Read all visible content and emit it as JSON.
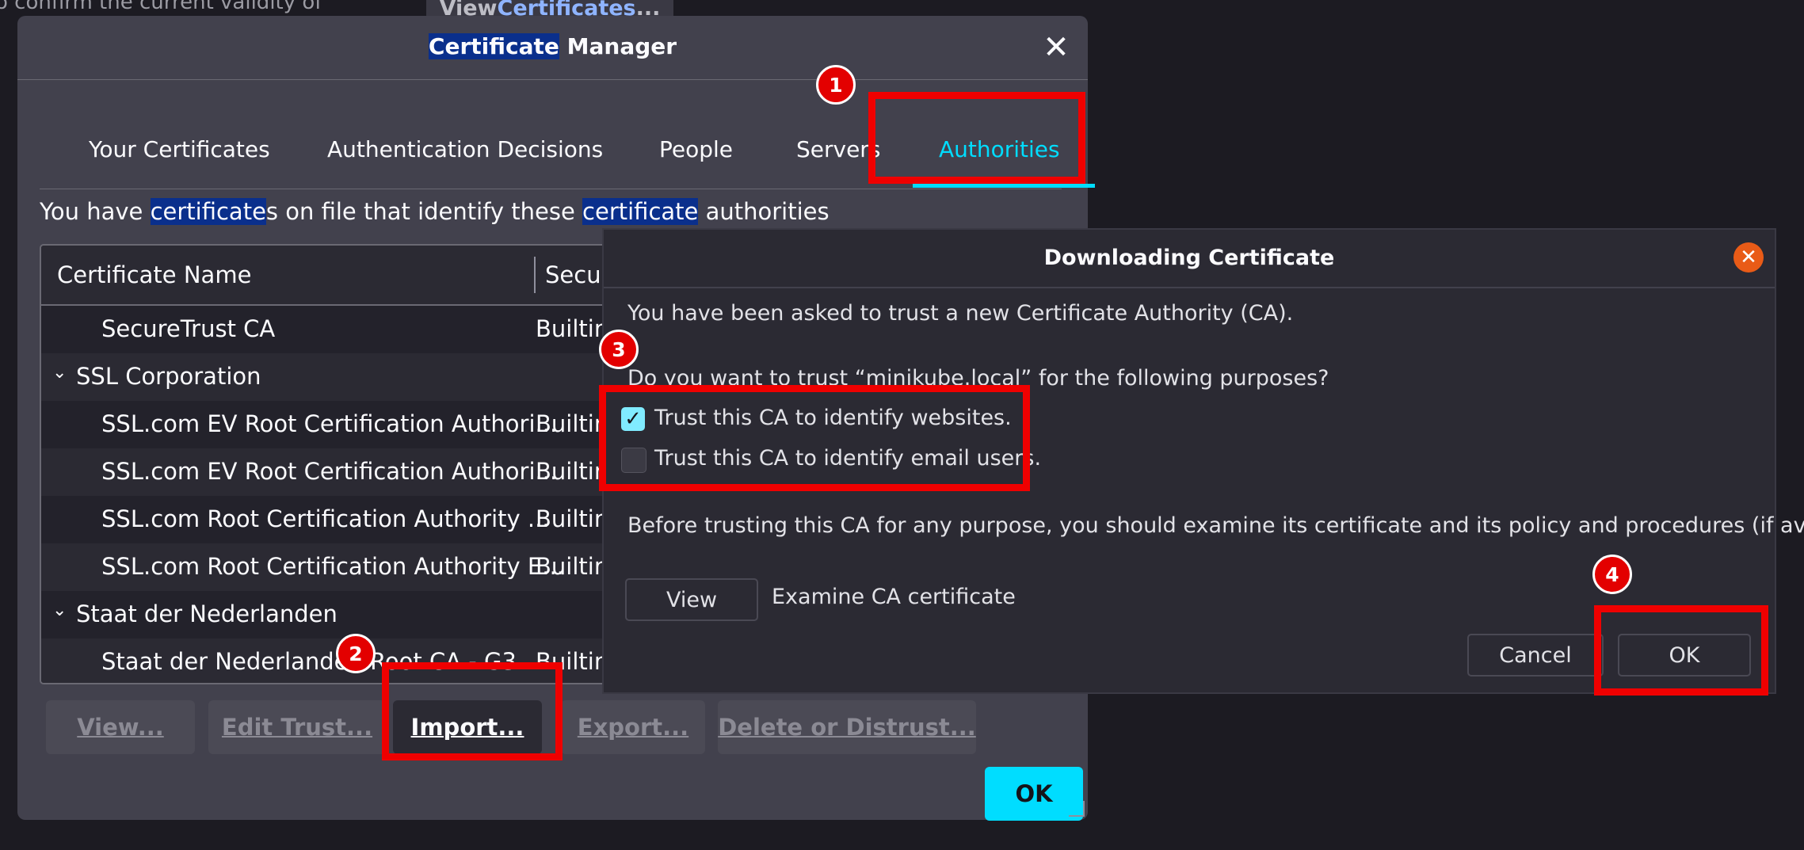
{
  "background": {
    "partial_text": "o confirm the current validity of",
    "view_button": {
      "prefix": "View ",
      "highlight": "Certificates",
      "suffix": "..."
    }
  },
  "manager": {
    "title_highlight": "Certificate",
    "title_rest": " Manager",
    "tabs": [
      "Your Certificates",
      "Authentication Decisions",
      "People",
      "Servers",
      "Authorities"
    ],
    "active_tab": "Authorities",
    "description": {
      "part1": "You have ",
      "hl1": "certificate",
      "part2": "s on file that identify these ",
      "hl2": "certificate",
      "part3": " authorities"
    },
    "columns": [
      "Certificate Name",
      "Secu"
    ],
    "rows": [
      {
        "name": "SecureTrust CA",
        "security": "Builtin",
        "group": false
      },
      {
        "name": "SSL Corporation",
        "security": "",
        "group": true
      },
      {
        "name": "SSL.com EV Root Certification Authori...",
        "security": "Builtin",
        "group": false
      },
      {
        "name": "SSL.com EV Root Certification Authori...",
        "security": "Builtin",
        "group": false
      },
      {
        "name": "SSL.com Root Certification Authority ...",
        "security": "Builtin",
        "group": false
      },
      {
        "name": "SSL.com Root Certification Authority E...",
        "security": "Builtin",
        "group": false
      },
      {
        "name": "Staat der Nederlanden",
        "security": "",
        "group": true
      },
      {
        "name": "Staat der Nederlanden Root CA - G3",
        "security": "Builtin",
        "group": false
      }
    ],
    "buttons": {
      "view": "View...",
      "edit_trust": "Edit Trust...",
      "import": "Import...",
      "export": "Export...",
      "delete": "Delete or Distrust..."
    },
    "ok": "OK"
  },
  "dialog": {
    "title": "Downloading Certificate",
    "line1": "You have been asked to trust a new Certificate Authority (CA).",
    "line2": "Do you want to trust “minikube.local” for the following purposes?",
    "check_websites": {
      "label": "Trust this CA to identify websites.",
      "checked": true
    },
    "check_email": {
      "label": "Trust this CA to identify email users.",
      "checked": false
    },
    "line3": "Before trusting this CA for any purpose, you should examine its certificate and its policy and procedures (if available).",
    "view_button": "View",
    "view_caption": "Examine CA certificate",
    "cancel": "Cancel",
    "ok": "OK"
  },
  "markers": [
    "1",
    "2",
    "3",
    "4"
  ],
  "colors": {
    "accent": "#00ddff",
    "annotation": "#ef0000",
    "dialog_close": "#e95b17"
  }
}
